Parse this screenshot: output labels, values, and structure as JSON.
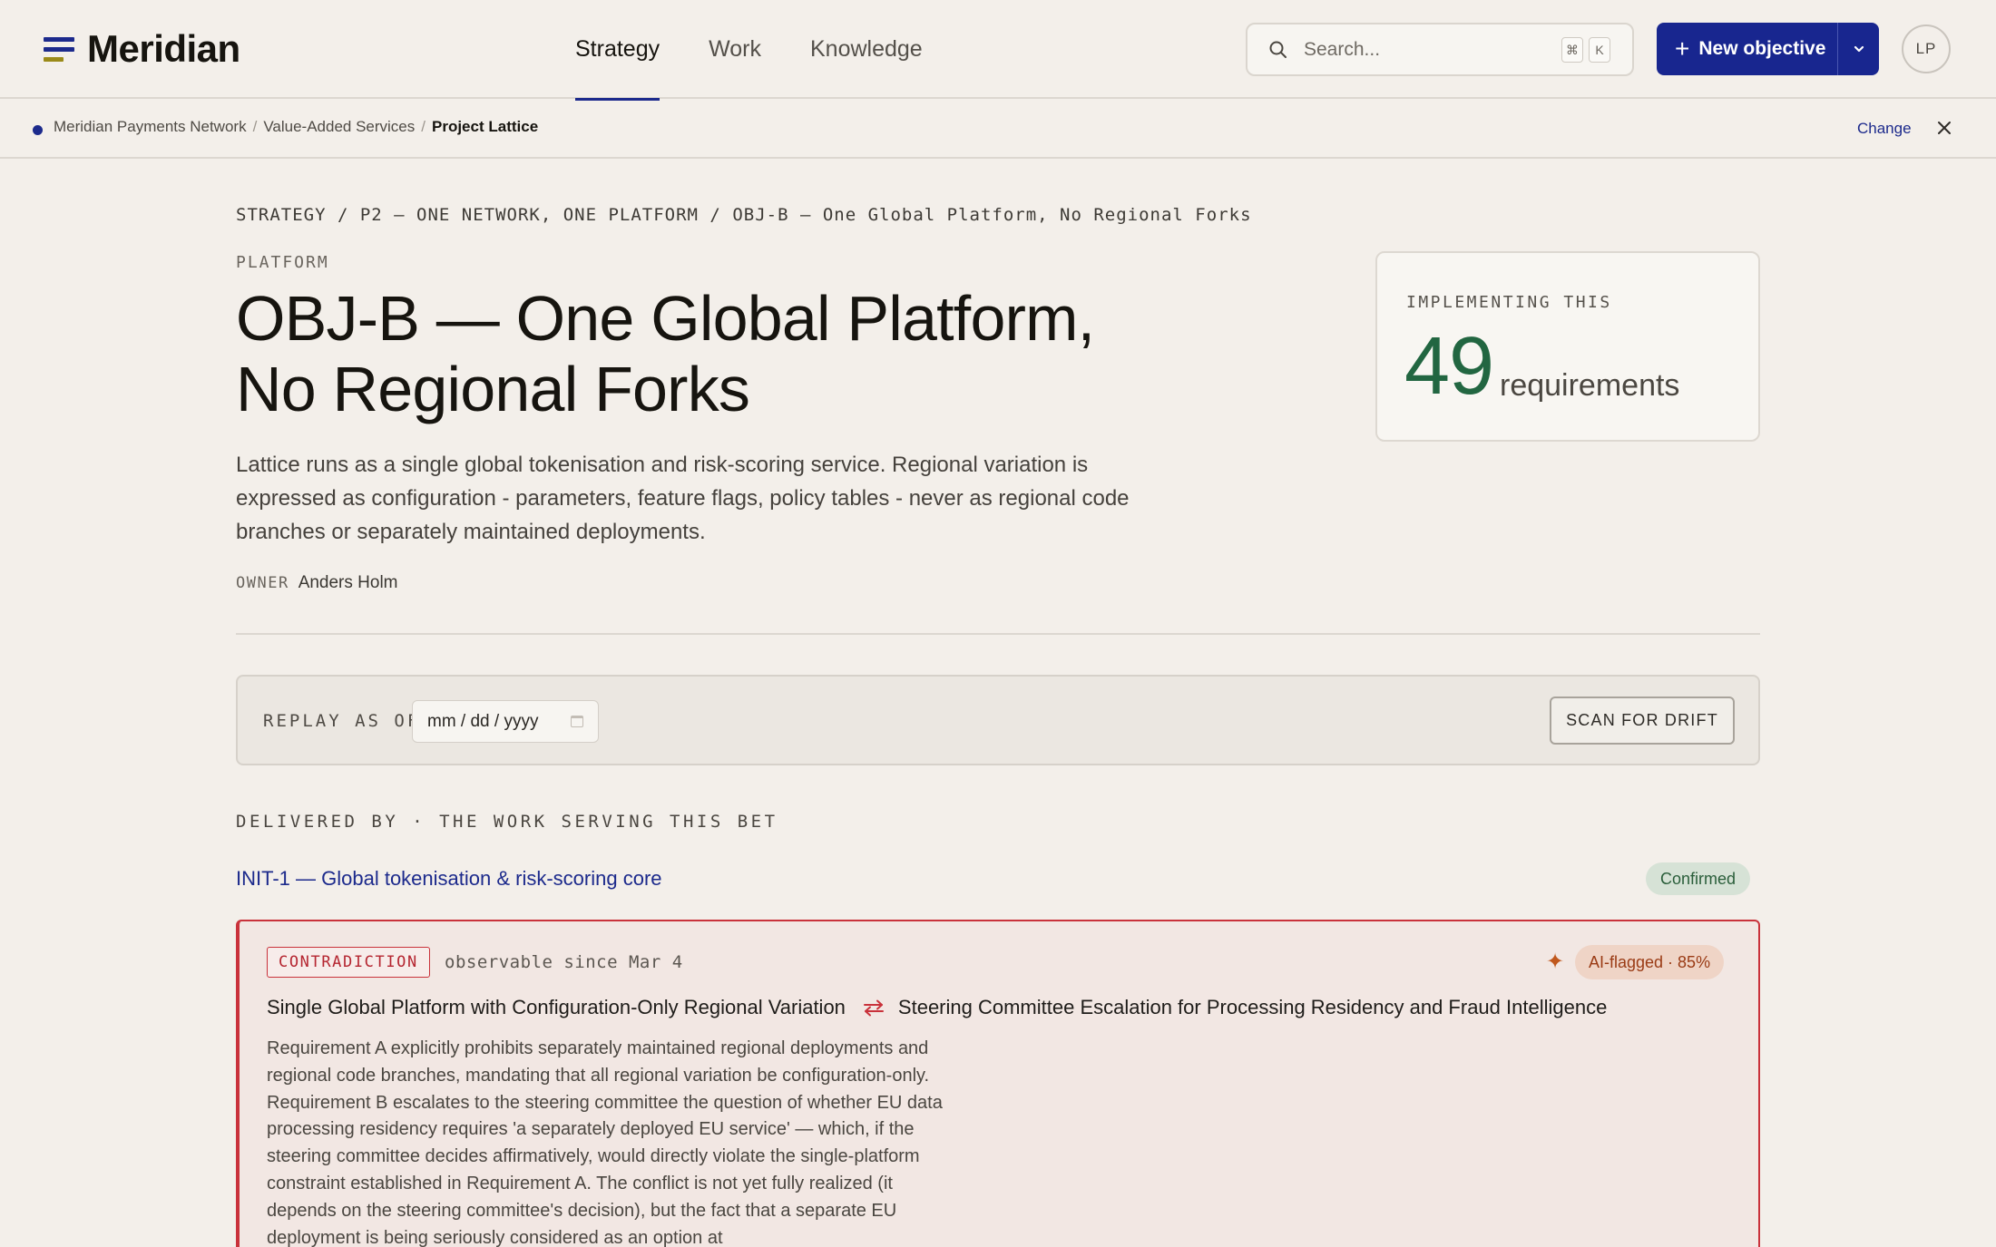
{
  "app": {
    "name": "Meridian"
  },
  "nav": {
    "items": [
      {
        "label": "Strategy",
        "active": true
      },
      {
        "label": "Work",
        "active": false
      },
      {
        "label": "Knowledge",
        "active": false
      }
    ]
  },
  "search": {
    "placeholder": "Search...",
    "shortcut_keys": [
      "⌘",
      "K"
    ]
  },
  "actions": {
    "new_objective_label": "New objective"
  },
  "user": {
    "initials": "LP"
  },
  "context": {
    "crumbs": [
      "Meridian Payments Network",
      "Value-Added Services",
      "Project Lattice"
    ],
    "change_label": "Change"
  },
  "objective": {
    "breadcrumb": "STRATEGY / P2 — ONE NETWORK, ONE PLATFORM / OBJ-B — One Global Platform, No Regional Forks",
    "category": "PLATFORM",
    "title": "OBJ-B — One Global Platform, No Regional Forks",
    "description": "Lattice runs as a single global tokenisation and risk-scoring service. Regional variation is expressed as configuration - parameters, feature flags, policy tables - never as regional code branches or separately maintained deployments.",
    "owner_label": "OWNER",
    "owner_name": "Anders Holm"
  },
  "implementing": {
    "label": "IMPLEMENTING THIS",
    "count": "49",
    "unit": "requirements"
  },
  "replay": {
    "label": "REPLAY AS OF",
    "date_placeholder": "mm / dd / yyyy",
    "scan_label": "SCAN FOR DRIFT"
  },
  "delivered": {
    "heading": "DELIVERED BY · THE WORK SERVING THIS BET",
    "initiative": {
      "label": "INIT-1 — Global tokenisation & risk-scoring core",
      "status": "Confirmed"
    }
  },
  "contradiction": {
    "tag": "CONTRADICTION",
    "since": "observable since Mar 4",
    "ai_badge": "AI-flagged · 85%",
    "requirement_a": "Single Global Platform with Configuration-Only Regional Variation",
    "requirement_b": "Steering Committee Escalation for Processing Residency and Fraud Intelligence",
    "body": "Requirement A explicitly prohibits separately maintained regional deployments and regional code branches, mandating that all regional variation be configuration-only. Requirement B escalates to the steering committee the question of whether EU data processing residency requires 'a separately deployed EU service' — which, if the steering committee decides affirmatively, would directly violate the single-platform constraint established in Requirement A. The conflict is not yet fully realized (it depends on the steering committee's decision), but the fact that a separate EU deployment is being seriously considered as an option at"
  },
  "colors": {
    "brand": "#18268f",
    "accent_green": "#226641",
    "alert_red": "#c9323b",
    "ai_orange": "#c0581d",
    "background": "#f3efea"
  }
}
